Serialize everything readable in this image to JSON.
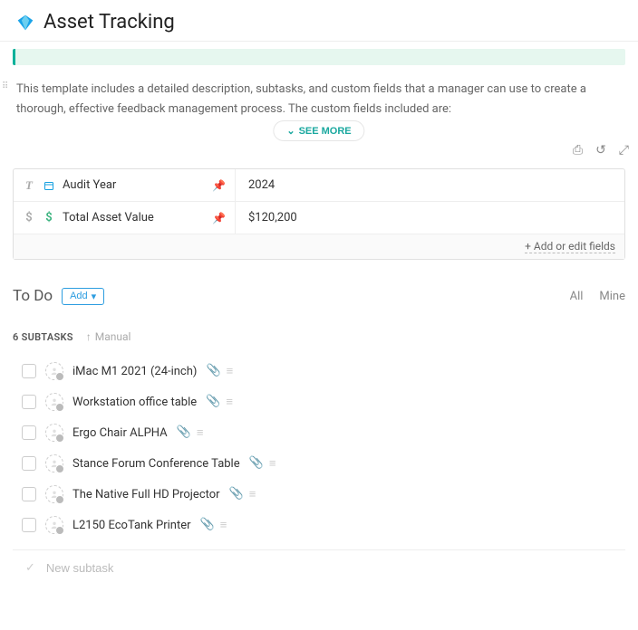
{
  "header": {
    "title": "Asset Tracking"
  },
  "description": {
    "text": "This template includes a detailed description, subtasks, and custom fields that a manager can use to create a thorough, effective feedback management process. The custom fields included are:",
    "see_more": "SEE MORE"
  },
  "fields": [
    {
      "icon1": "T",
      "icon2": "cal",
      "name": "Audit Year",
      "value": "2024"
    },
    {
      "icon1": "$",
      "icon2": "$g",
      "name": "Total Asset Value",
      "value": "$120,200"
    }
  ],
  "fields_footer": "+ Add or edit fields",
  "section": {
    "title": "To Do",
    "add_label": "Add",
    "filters": {
      "all": "All",
      "mine": "Mine"
    }
  },
  "subtasks_bar": {
    "count_label": "6 SUBTASKS",
    "sort": "Manual"
  },
  "tasks": [
    {
      "title": "iMac M1 2021 (24-inch)"
    },
    {
      "title": "Workstation office table"
    },
    {
      "title": "Ergo Chair ALPHA"
    },
    {
      "title": "Stance Forum Conference Table"
    },
    {
      "title": "The Native Full HD Projector"
    },
    {
      "title": "L2150 EcoTank Printer"
    }
  ],
  "new_subtask": {
    "placeholder": "New subtask"
  }
}
